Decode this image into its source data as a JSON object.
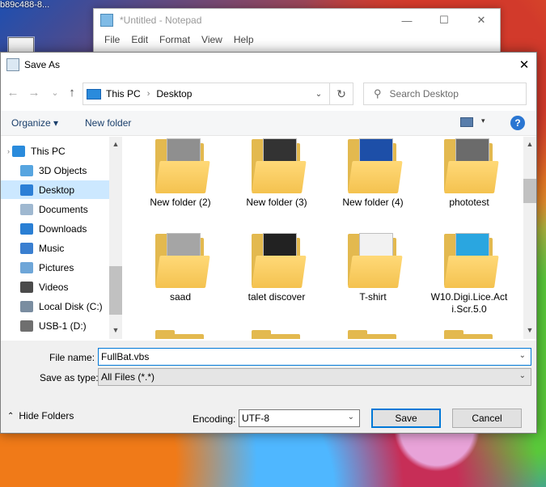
{
  "desktop": {
    "label": "b89c488-8..."
  },
  "notepad": {
    "title": "*Untitled - Notepad",
    "menu": [
      "File",
      "Edit",
      "Format",
      "View",
      "Help"
    ],
    "controls": {
      "minimize": "—",
      "maximize": "☐",
      "close": "✕"
    }
  },
  "dialog": {
    "title": "Save As",
    "close_glyph": "✕",
    "nav": {
      "back": "←",
      "forward": "→",
      "recent": "⌄",
      "up": "↑"
    },
    "address": {
      "segments": [
        "This PC",
        "Desktop"
      ],
      "separator": "›",
      "dropdown": "⌄",
      "refresh": "↻"
    },
    "search": {
      "placeholder": "Search Desktop",
      "icon": "⚲"
    },
    "toolbar": {
      "organize": "Organize ▾",
      "new_folder": "New folder",
      "view_dropdown": "▾",
      "help": "?"
    },
    "sidebar": {
      "items": [
        {
          "label": "This PC",
          "icon": "computer-icon",
          "color": "#2a8bdc"
        },
        {
          "label": "3D Objects",
          "icon": "3d-objects-icon",
          "color": "#57a5e0"
        },
        {
          "label": "Desktop",
          "icon": "desktop-icon",
          "color": "#2c7fd6",
          "selected": true
        },
        {
          "label": "Documents",
          "icon": "documents-icon",
          "color": "#9fb8d0"
        },
        {
          "label": "Downloads",
          "icon": "downloads-icon",
          "color": "#2a7fd4"
        },
        {
          "label": "Music",
          "icon": "music-icon",
          "color": "#3a7fd0"
        },
        {
          "label": "Pictures",
          "icon": "pictures-icon",
          "color": "#6ea6d8"
        },
        {
          "label": "Videos",
          "icon": "videos-icon",
          "color": "#4b4b4b"
        },
        {
          "label": "Local Disk (C:)",
          "icon": "drive-icon",
          "color": "#7a8da0"
        },
        {
          "label": "USB-1 (D:)",
          "icon": "usb-drive-icon",
          "color": "#6f6f6f"
        }
      ]
    },
    "files": [
      {
        "name": "New folder (2)",
        "thumb": "#8f8f8f"
      },
      {
        "name": "New folder (3)",
        "thumb": "#333333"
      },
      {
        "name": "New folder (4)",
        "thumb": "#1d4fa8"
      },
      {
        "name": "phototest",
        "thumb": "#6b6b6b"
      },
      {
        "name": "saad",
        "thumb": "#a5a5a5"
      },
      {
        "name": "talet discover",
        "thumb": "#222222"
      },
      {
        "name": "T-shirt",
        "thumb": "#f2f2f2"
      },
      {
        "name": "W10.Digi.Lice.Act i.Scr.5.0",
        "thumb": "#2aa6e0"
      }
    ],
    "scroll_glyphs": {
      "up": "▲",
      "down": "▼"
    },
    "filename": {
      "label": "File name:",
      "value": "FullBat.vbs"
    },
    "savetype": {
      "label": "Save as type:",
      "value": "All Files  (*.*)"
    },
    "encoding": {
      "label": "Encoding:",
      "value": "UTF-8"
    },
    "buttons": {
      "save": "Save",
      "cancel": "Cancel",
      "hide_folders": "Hide Folders"
    },
    "dropdown_glyph": "⌄",
    "hide_caret": "⌃"
  }
}
